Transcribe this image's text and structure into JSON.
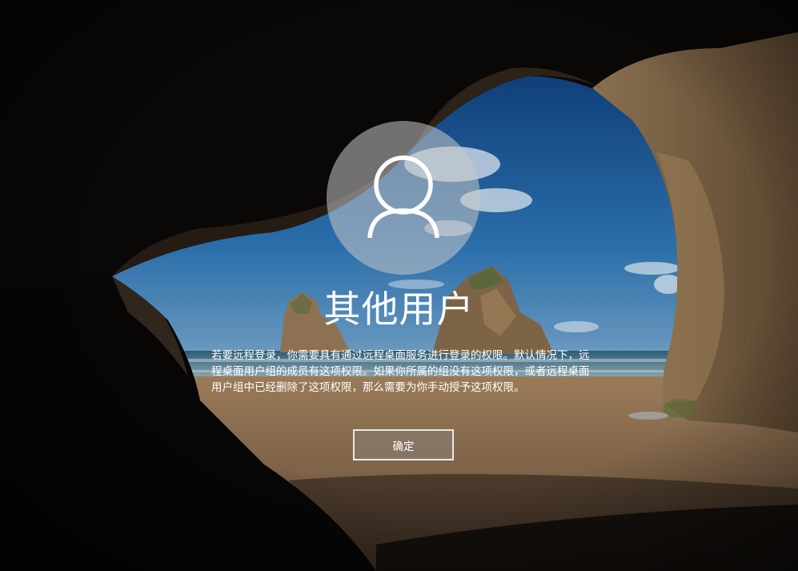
{
  "login": {
    "username": "其他用户",
    "message": "若要远程登录，你需要具有通过远程桌面服务进行登录的权限。默认情况下，远程桌面用户组的成员有这项权限。如果你所属的组没有这项权限，或者远程桌面用户组中已经删除了这项权限，那么需要为你手动授予这项权限。",
    "ok_label": "确定",
    "avatar_icon": "user-silhouette-icon"
  },
  "background": {
    "scene": "sea-cave-beach",
    "colors": {
      "sky": "#1e5d9a",
      "sand": "#8a6e4f",
      "rock": "#6b5a40",
      "cave": "#050505"
    }
  }
}
